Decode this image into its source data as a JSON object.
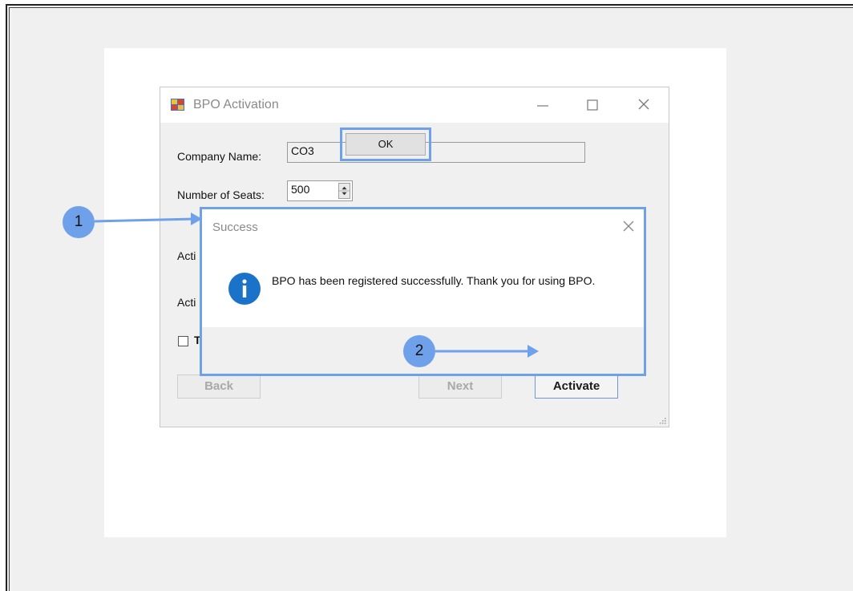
{
  "window": {
    "title": "BPO Activation",
    "minimize_glyph": "—",
    "maximize_glyph": "☐",
    "close_glyph": "✕"
  },
  "form": {
    "company_name_label": "Company Name:",
    "company_name_value": "CO3",
    "seats_label": "Number of Seats:",
    "seats_value": "500",
    "activation_label_1_partial": "Acti",
    "activation_label_2_partial": "Acti",
    "checkbox_label_partial": "T"
  },
  "buttons": {
    "back": "Back",
    "next": "Next",
    "activate": "Activate"
  },
  "dialog": {
    "title": "Success",
    "icon": "information-icon",
    "message": "BPO has been registered successfully.  Thank you for using BPO.",
    "ok": "OK"
  },
  "callouts": [
    {
      "number": "1"
    },
    {
      "number": "2"
    }
  ],
  "colors": {
    "highlight": "#6fa0ea",
    "info_icon": "#1a73c8",
    "app_background": "#f0f0f0"
  }
}
